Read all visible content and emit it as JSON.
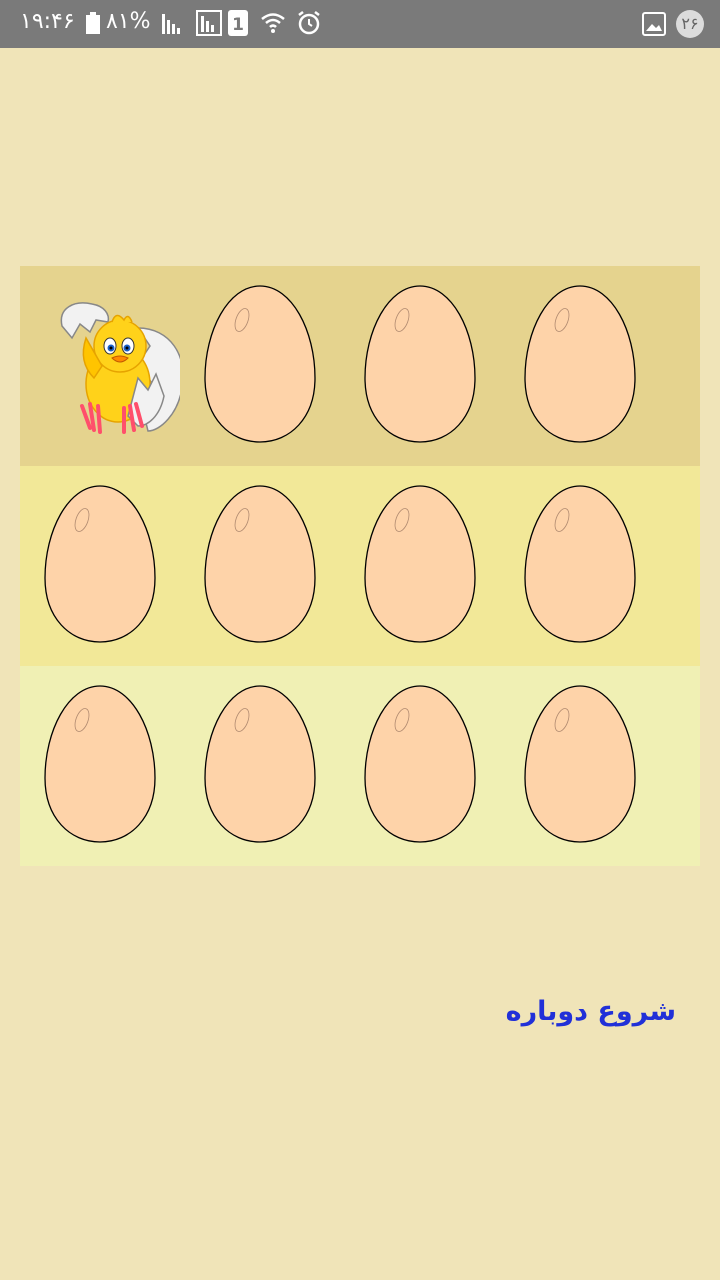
{
  "status_bar": {
    "time": "۱۹:۴۶",
    "battery": "۸۱%",
    "notification_count": "۲۶",
    "icons": [
      "battery-icon",
      "signal-icon",
      "signal-icon",
      "sim-1-icon",
      "wifi-icon",
      "alarm-icon",
      "gallery-icon"
    ]
  },
  "game": {
    "rows": 3,
    "columns": 4,
    "cells": [
      [
        "chick",
        "egg",
        "egg",
        "egg"
      ],
      [
        "egg",
        "egg",
        "egg",
        "egg"
      ],
      [
        "egg",
        "egg",
        "egg",
        "egg"
      ]
    ],
    "row_colors": [
      "#e5d38e",
      "#f2e898",
      "#f0f0b4"
    ],
    "egg_color": "#fed3a9"
  },
  "restart_label": "شروع دوباره",
  "colors": {
    "background": "#f0e4b8",
    "status_bar": "#7a7a7a",
    "restart_text": "#2130d8"
  }
}
